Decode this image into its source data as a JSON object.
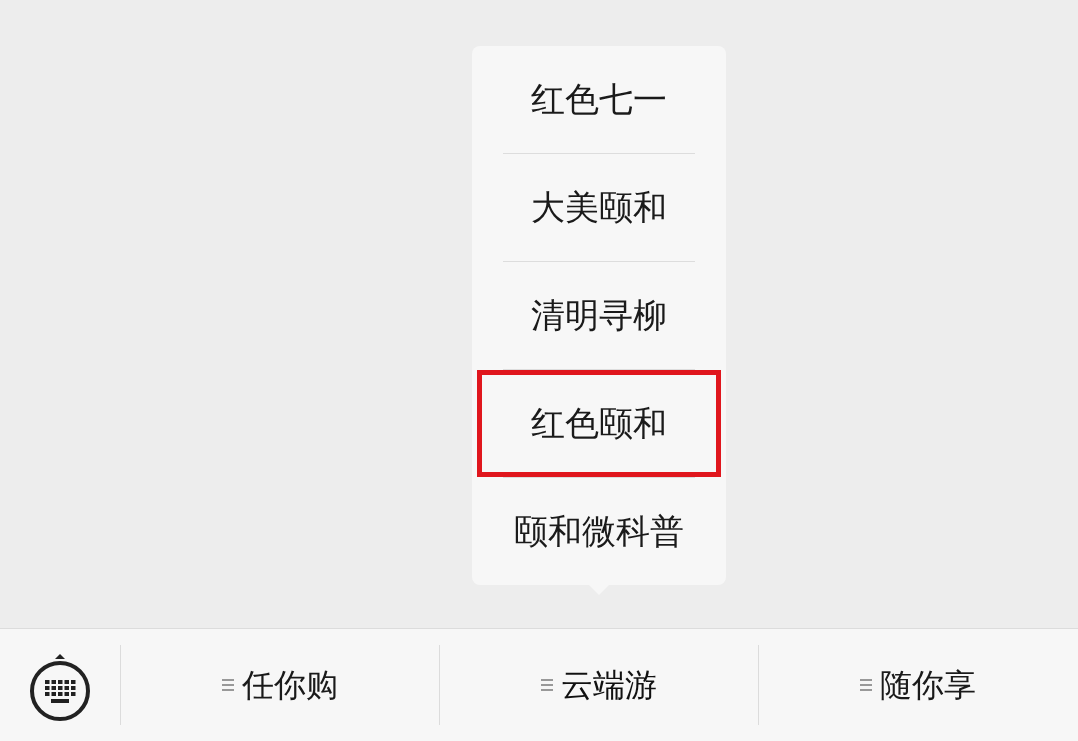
{
  "popup_menu": {
    "items": [
      {
        "label": "红色七一",
        "highlighted": false
      },
      {
        "label": "大美颐和",
        "highlighted": false
      },
      {
        "label": "清明寻柳",
        "highlighted": false
      },
      {
        "label": "红色颐和",
        "highlighted": true
      },
      {
        "label": "颐和微科普",
        "highlighted": false
      }
    ]
  },
  "bottom_menu": {
    "tabs": [
      {
        "label": "任你购",
        "selected": false
      },
      {
        "label": "云端游",
        "selected": true
      },
      {
        "label": "随你享",
        "selected": false
      }
    ]
  }
}
